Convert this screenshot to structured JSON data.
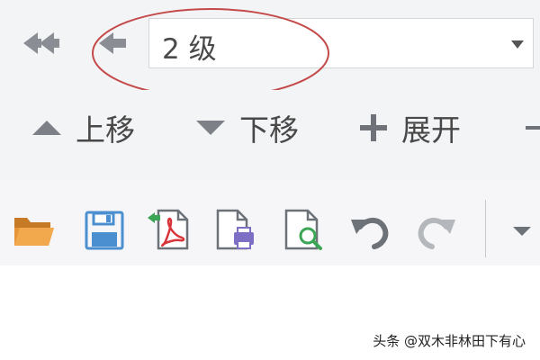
{
  "navigation": {
    "back_icon": "double-arrow-left-icon",
    "up_level_icon": "arrow-left-icon",
    "level_select": {
      "value": "2 级"
    }
  },
  "outline_commands": {
    "move_up": {
      "label": "上移",
      "icon": "triangle-up-icon"
    },
    "move_down": {
      "label": "下移",
      "icon": "triangle-down-icon"
    },
    "expand": {
      "label": "展开",
      "icon": "plus-icon"
    }
  },
  "toolbar": {
    "icons": [
      "folder-open-icon",
      "save-icon",
      "export-pdf-icon",
      "print-preview-icon",
      "preview-search-icon",
      "undo-icon",
      "redo-icon",
      "more-dropdown-icon"
    ]
  },
  "colors": {
    "toolbar_background": "#f3f4f6",
    "icon_gray": "#8a8e94",
    "save_blue": "#4b8fd1",
    "folder_orange": "#e8953a",
    "pdf_red": "#d9343a",
    "highlight_oval": "#c44a4a"
  },
  "watermark": {
    "text": "头条 @双木非林田下有心"
  }
}
